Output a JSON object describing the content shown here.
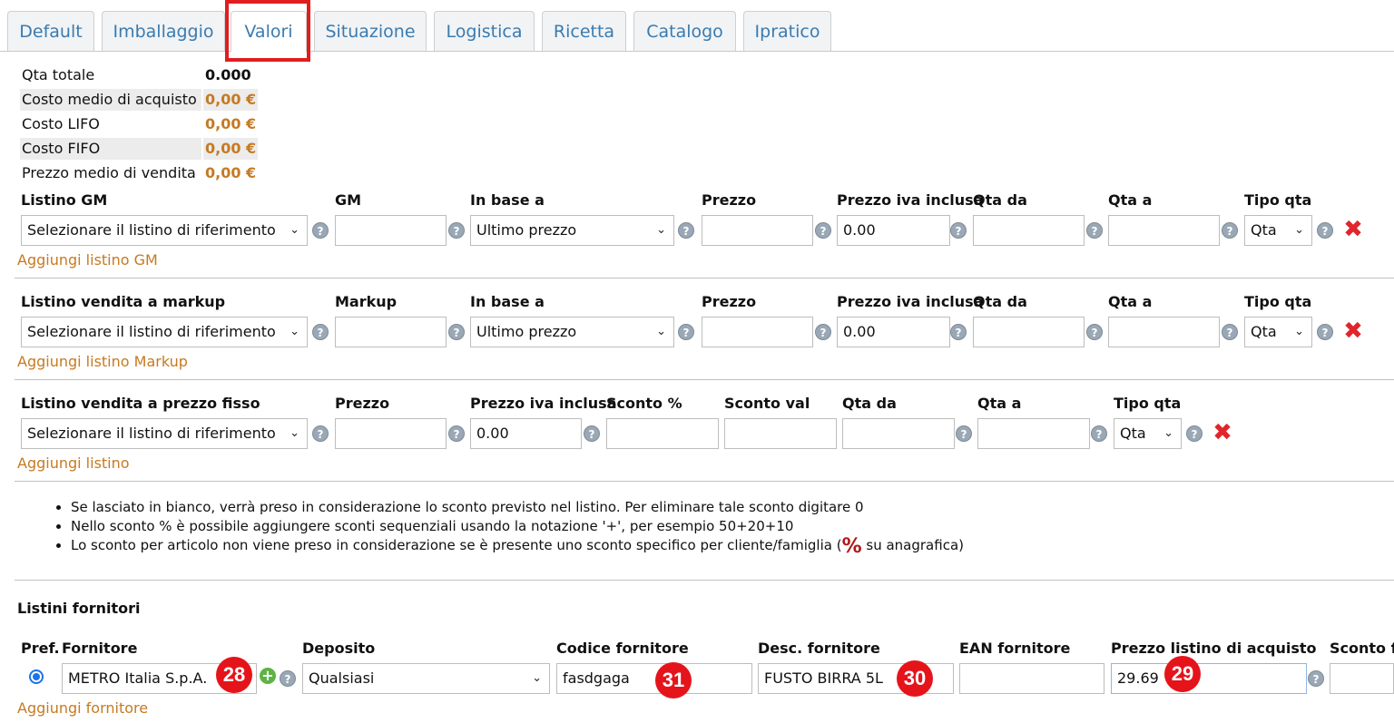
{
  "tabs": [
    "Default",
    "Imballaggio",
    "Valori",
    "Situazione",
    "Logistica",
    "Ricetta",
    "Catalogo",
    "Ipratico"
  ],
  "active_tab": "Valori",
  "summary": [
    {
      "label": "Qta totale",
      "value": "0.000"
    },
    {
      "label": "Costo medio di acquisto",
      "value": "0,00 €"
    },
    {
      "label": "Costo LIFO",
      "value": "0,00 €"
    },
    {
      "label": "Costo FIFO",
      "value": "0,00 €"
    },
    {
      "label": "Prezzo medio di vendita",
      "value": "0,00 €"
    }
  ],
  "help_glyph": "?",
  "delete_glyph": "✖",
  "chevron_glyph": "⌄",
  "listino_gm": {
    "headers": [
      "Listino GM",
      "GM",
      "In base a",
      "Prezzo",
      "Prezzo iva inclusa",
      "Qta da",
      "Qta a",
      "Tipo qta"
    ],
    "listino_value": "Selezionare il listino di riferimento",
    "gm_value": "",
    "base_value": "Ultimo prezzo",
    "prezzo_value": "",
    "prezzo_iva_value": "0.00",
    "qta_da_value": "",
    "qta_a_value": "",
    "tipo_qta_value": "Qta",
    "add_link": "Aggiungi listino GM"
  },
  "listino_markup": {
    "headers": [
      "Listino vendita a markup",
      "Markup",
      "In base a",
      "Prezzo",
      "Prezzo iva inclusa",
      "Qta da",
      "Qta a",
      "Tipo qta"
    ],
    "listino_value": "Selezionare il listino di riferimento",
    "markup_value": "",
    "base_value": "Ultimo prezzo",
    "prezzo_value": "",
    "prezzo_iva_value": "0.00",
    "qta_da_value": "",
    "qta_a_value": "",
    "tipo_qta_value": "Qta",
    "add_link": "Aggiungi listino Markup"
  },
  "listino_fisso": {
    "headers": [
      "Listino vendita a prezzo fisso",
      "Prezzo",
      "Prezzo iva inclusa",
      "Sconto %",
      "Sconto val",
      "Qta da",
      "Qta a",
      "Tipo qta"
    ],
    "listino_value": "Selezionare il listino di riferimento",
    "prezzo_value": "",
    "prezzo_iva_value": "0.00",
    "sconto_pct_value": "",
    "sconto_val_value": "",
    "qta_da_value": "",
    "qta_a_value": "",
    "tipo_qta_value": "Qta",
    "add_link": "Aggiungi listino"
  },
  "notes": [
    "Se lasciato in bianco, verrà preso in considerazione lo sconto previsto nel listino. Per eliminare tale sconto digitare 0",
    "Nello sconto % è possibile aggiungere sconti sequenziali usando la notazione '+', per esempio 50+20+10"
  ],
  "note3_before": "Lo sconto per articolo non viene preso in considerazione se è presente uno sconto specifico per cliente/famiglia (",
  "note3_icon": "%",
  "note3_after": " su anagrafica)",
  "fornitori": {
    "section_title": "Listini fornitori",
    "headers": [
      "Pref.",
      "Fornitore",
      "Deposito",
      "Codice fornitore",
      "Desc. fornitore",
      "EAN fornitore",
      "Prezzo listino di acquisto",
      "Sconto fo"
    ],
    "fornitore_value": "METRO Italia S.p.A.",
    "plus_glyph": "+",
    "deposito_value": "Qualsiasi",
    "codice_value": "fasdgaga",
    "desc_value": "FUSTO BIRRA 5L",
    "ean_value": "",
    "prezzo_value": "29.69",
    "sconto_value": "",
    "add_link": "Aggiungi fornitore"
  },
  "badges": [
    "28",
    "31",
    "30",
    "29"
  ]
}
